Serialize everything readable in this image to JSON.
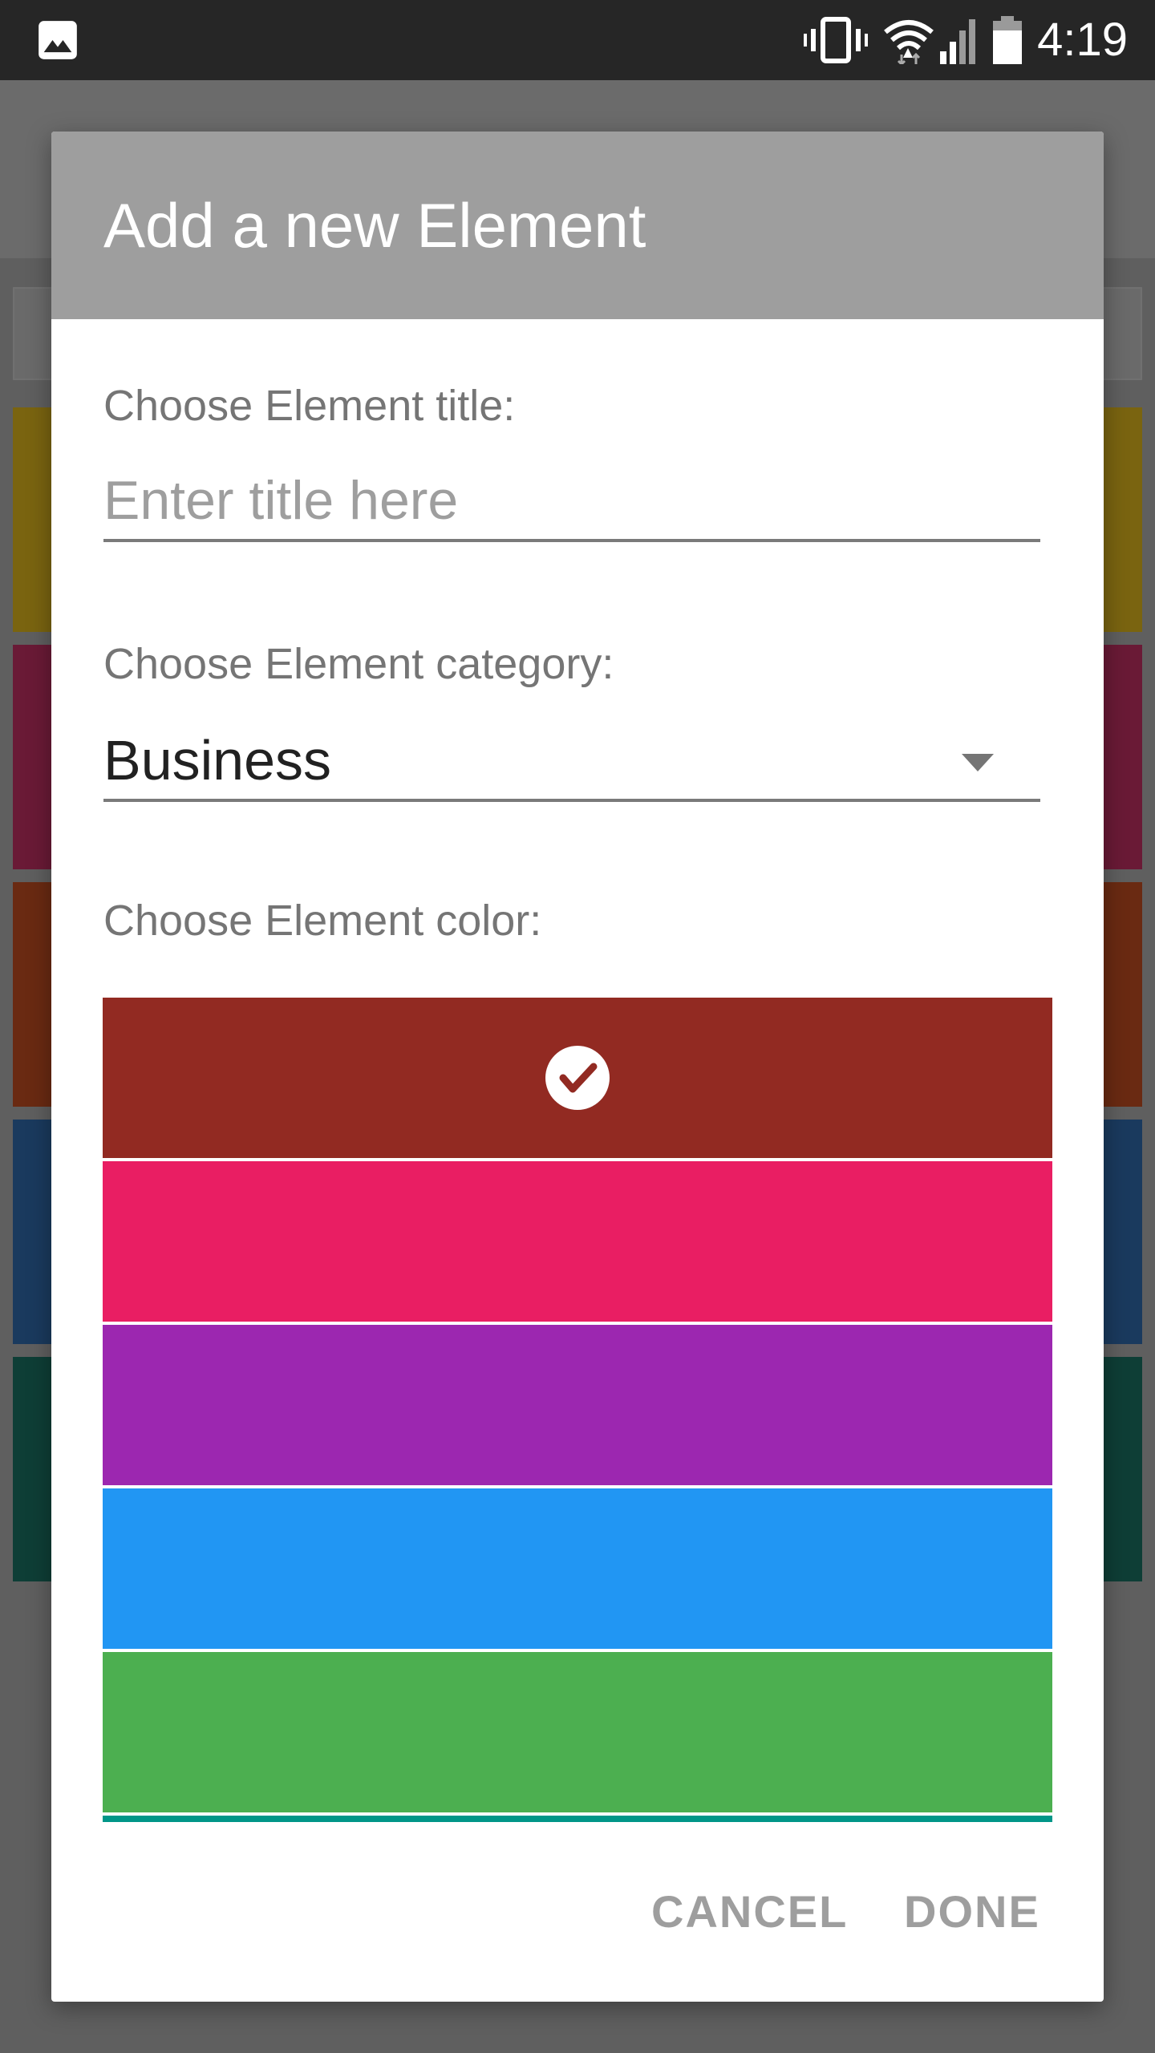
{
  "status_bar": {
    "time": "4:19",
    "icons": [
      "image-icon",
      "vibrate-icon",
      "wifi-icon",
      "signal-icon",
      "battery-icon"
    ]
  },
  "dialog": {
    "title": "Add a new Element",
    "title_label": "Choose Element title:",
    "title_placeholder": "Enter title here",
    "title_value": "",
    "category_label": "Choose Element category:",
    "category_value": "Business",
    "color_label": "Choose Element color:",
    "colors": [
      {
        "hex": "#922A22",
        "selected": true
      },
      {
        "hex": "#E91E63",
        "selected": false
      },
      {
        "hex": "#9C27B0",
        "selected": false
      },
      {
        "hex": "#2196F3",
        "selected": false
      },
      {
        "hex": "#4CAF50",
        "selected": false
      },
      {
        "hex": "#009688",
        "selected": false
      }
    ],
    "cancel_label": "CANCEL",
    "done_label": "DONE"
  },
  "background_cards": {
    "colors": [
      "#7a6410",
      "#6a1a36",
      "#6a2a12",
      "#1a3a5e",
      "#0e3e36"
    ]
  }
}
